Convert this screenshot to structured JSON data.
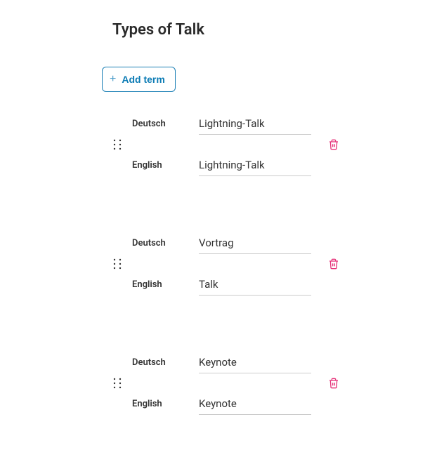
{
  "title": "Types of Talk",
  "addButton": {
    "label": "Add term"
  },
  "languages": {
    "de": "Deutsch",
    "en": "English"
  },
  "terms": [
    {
      "de": "Lightning-Talk",
      "en": "Lightning-Talk"
    },
    {
      "de": "Vortrag",
      "en": "Talk"
    },
    {
      "de": "Keynote",
      "en": "Keynote"
    }
  ]
}
